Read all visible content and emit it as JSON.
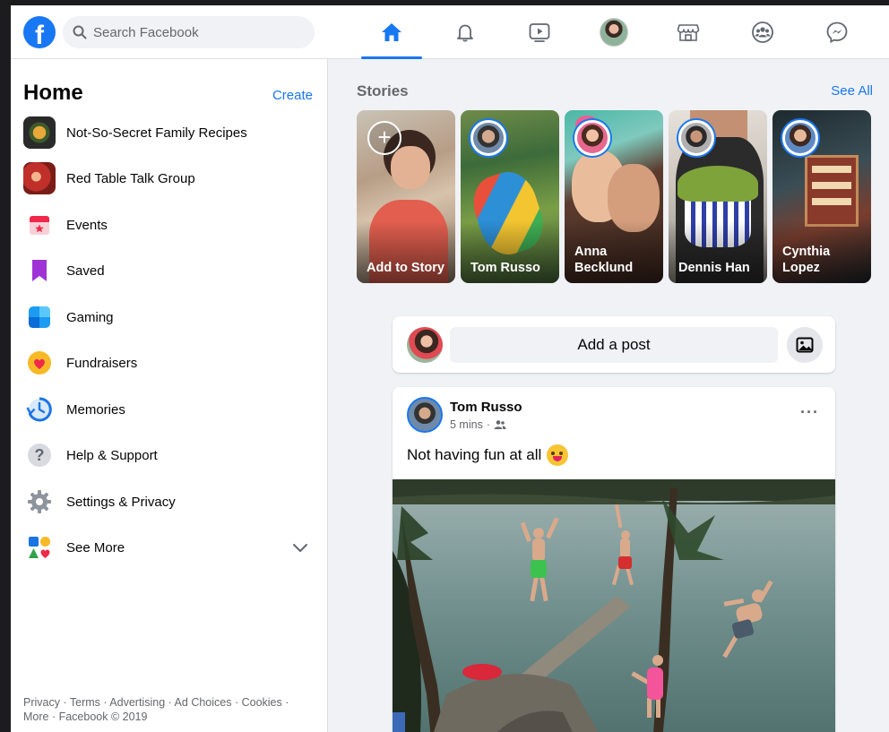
{
  "search": {
    "placeholder": "Search Facebook"
  },
  "nav": {
    "icons": [
      "home-icon",
      "bell-icon",
      "watch-icon",
      "profile-avatar",
      "marketplace-icon",
      "groups-icon",
      "messenger-icon"
    ],
    "active": "home-icon",
    "accent": "#1877f2"
  },
  "sidebar": {
    "title": "Home",
    "create_label": "Create",
    "items": [
      {
        "label": "Not-So-Secret Family Recipes"
      },
      {
        "label": "Red Table Talk Group"
      },
      {
        "label": "Events"
      },
      {
        "label": "Saved"
      },
      {
        "label": "Gaming"
      },
      {
        "label": "Fundraisers"
      },
      {
        "label": "Memories"
      },
      {
        "label": "Help & Support"
      },
      {
        "label": "Settings & Privacy"
      },
      {
        "label": "See More"
      }
    ],
    "footer": "Privacy · Terms · Advertising · Ad Choices · Cookies · More · Facebook © 2019"
  },
  "stories": {
    "title": "Stories",
    "see_all": "See All",
    "items": [
      {
        "name": "Add to Story"
      },
      {
        "name": "Tom Russo"
      },
      {
        "name": "Anna Becklund"
      },
      {
        "name": "Dennis Han"
      },
      {
        "name": "Cynthia Lopez"
      }
    ]
  },
  "composer": {
    "prompt": "Add a post"
  },
  "post": {
    "author": "Tom Russo",
    "time": "5 mins",
    "text": "Not having fun at all"
  }
}
